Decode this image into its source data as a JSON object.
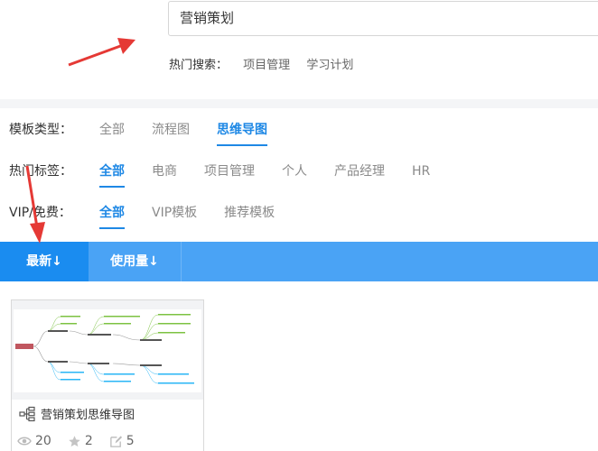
{
  "search": {
    "value": "营销策划"
  },
  "hot_search": {
    "label": "热门搜索：",
    "items": [
      "项目管理",
      "学习计划"
    ]
  },
  "filters": {
    "type": {
      "label": "模板类型：",
      "options": [
        "全部",
        "流程图",
        "思维导图"
      ],
      "active": 2
    },
    "tags": {
      "label": "热门标签：",
      "options": [
        "全部",
        "电商",
        "项目管理",
        "个人",
        "产品经理",
        "HR"
      ],
      "active": 0
    },
    "vip": {
      "label": "VIP/免费：",
      "options": [
        "全部",
        "VIP模板",
        "推荐模板"
      ],
      "active": 0
    }
  },
  "sort": {
    "tabs": [
      "最新↓",
      "使用量↓"
    ],
    "active": 0
  },
  "card": {
    "title": "营销策划思维导图",
    "views": "20",
    "stars": "2",
    "edits": "5"
  },
  "colors": {
    "accent": "#1e88e5",
    "sortbar": "#4aa3f5",
    "arrow": "#e53935"
  }
}
